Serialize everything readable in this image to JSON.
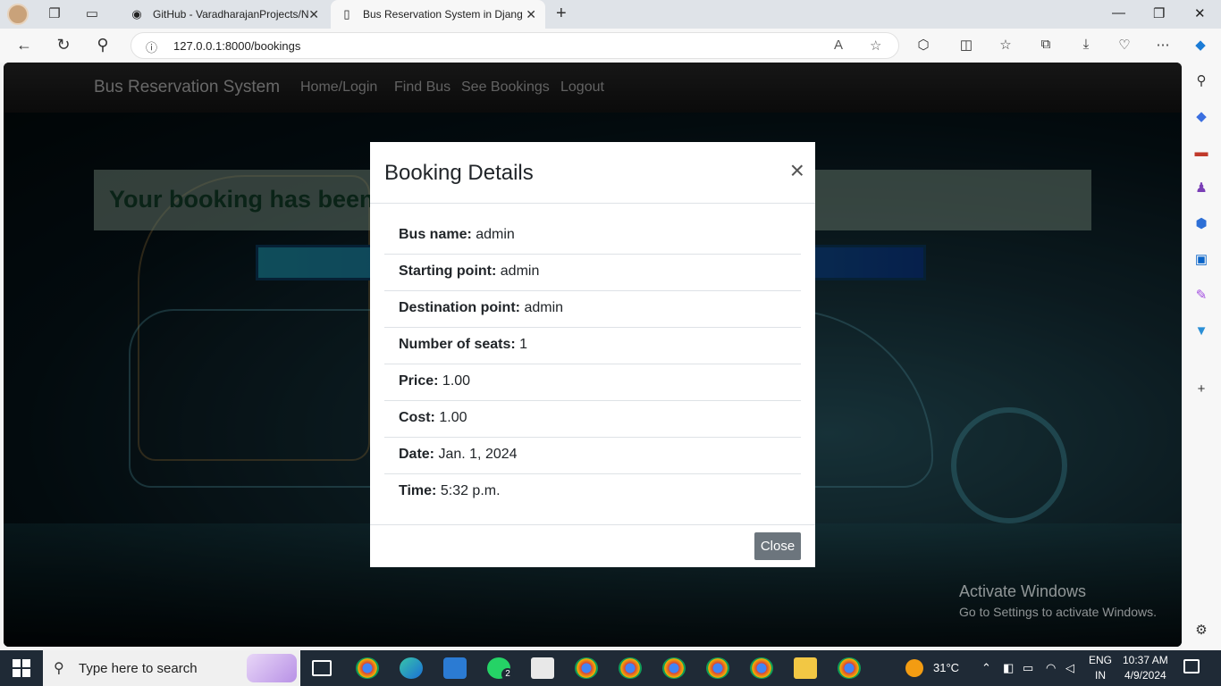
{
  "browser": {
    "tabs": [
      {
        "title": "GitHub - VaradharajanProjects/N",
        "active": false
      },
      {
        "title": "Bus Reservation System in Djang",
        "active": true
      }
    ],
    "url": "127.0.0.1:8000/bookings"
  },
  "navbar": {
    "brand": "Bus Reservation System",
    "links": [
      "Home/Login",
      "Find Bus",
      "See Bookings",
      "Logout"
    ]
  },
  "alert": {
    "text": "Your booking has been"
  },
  "modal": {
    "title": "Booking Details",
    "close_icon": "×",
    "rows": [
      {
        "label": "Bus name:",
        "value": "admin"
      },
      {
        "label": "Starting point:",
        "value": "admin"
      },
      {
        "label": "Destination point:",
        "value": "admin"
      },
      {
        "label": "Number of seats:",
        "value": "1"
      },
      {
        "label": "Price:",
        "value": "1.00"
      },
      {
        "label": "Cost:",
        "value": "1.00"
      },
      {
        "label": "Date:",
        "value": "Jan. 1, 2024"
      },
      {
        "label": "Time:",
        "value": "5:32 p.m."
      }
    ],
    "close_button": "Close"
  },
  "watermark": {
    "line1": "Activate Windows",
    "line2": "Go to Settings to activate Windows."
  },
  "taskbar": {
    "search_placeholder": "Type here to search",
    "whatsapp_badge": "2",
    "weather": "31°C",
    "lang_line1": "ENG",
    "lang_line2": "IN",
    "time": "10:37 AM",
    "date": "4/9/2024"
  }
}
